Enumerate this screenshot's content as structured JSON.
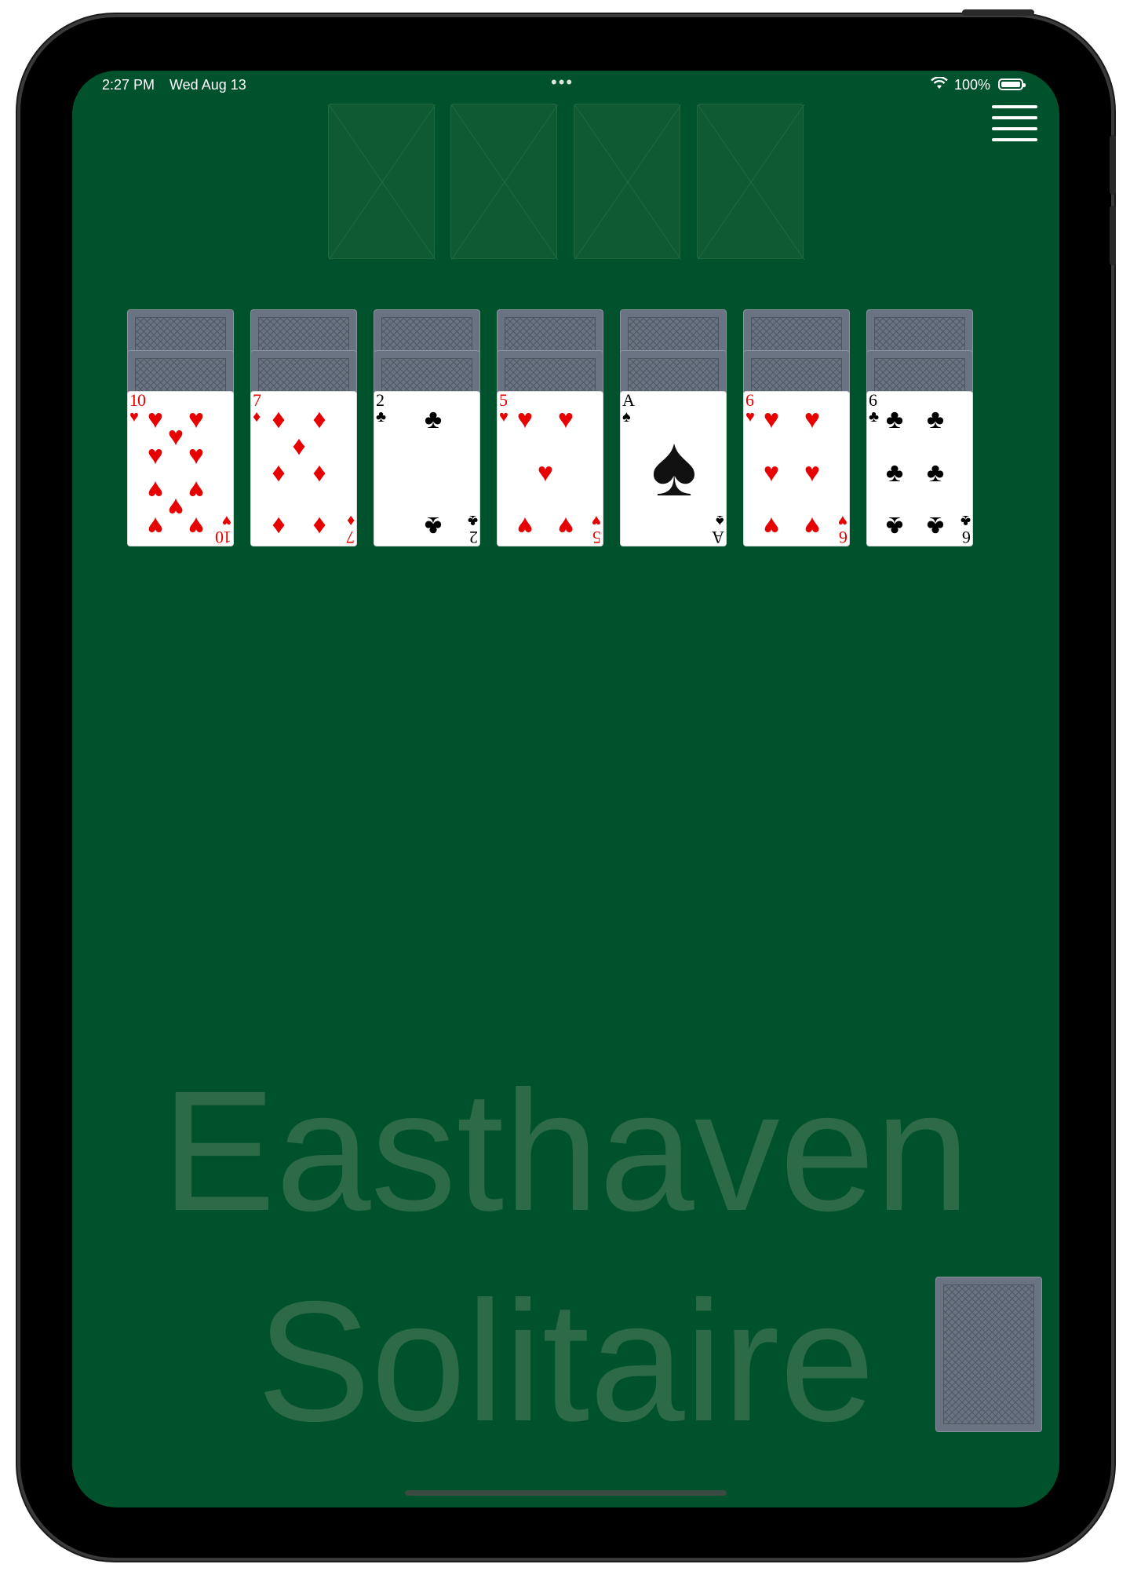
{
  "status": {
    "time": "2:27 PM",
    "date": "Wed Aug 13",
    "dots": "•••",
    "battery_pct": "100%"
  },
  "icons": {
    "menu": "hamburger-menu-icon",
    "wifi": "wifi-icon",
    "battery": "battery-icon"
  },
  "colors": {
    "table_felt": "#00522c",
    "card_back": "#6a7381",
    "red_suit": "#e60000",
    "watermark": "#2c6a48"
  },
  "foundations": [
    {
      "label": ""
    },
    {
      "label": ""
    },
    {
      "label": ""
    },
    {
      "label": ""
    }
  ],
  "tableau": [
    {
      "hidden": 2,
      "rank": "10",
      "suit": "♥",
      "color": "red"
    },
    {
      "hidden": 2,
      "rank": "7",
      "suit": "♦",
      "color": "red"
    },
    {
      "hidden": 2,
      "rank": "2",
      "suit": "♣",
      "color": "black"
    },
    {
      "hidden": 2,
      "rank": "5",
      "suit": "♥",
      "color": "red"
    },
    {
      "hidden": 2,
      "rank": "A",
      "suit": "♠",
      "color": "black"
    },
    {
      "hidden": 2,
      "rank": "6",
      "suit": "♥",
      "color": "red"
    },
    {
      "hidden": 2,
      "rank": "6",
      "suit": "♣",
      "color": "black"
    }
  ],
  "stock": {
    "cards_visible": 1
  },
  "watermark": {
    "line1": "Easthaven",
    "line2": "Solitaire"
  }
}
